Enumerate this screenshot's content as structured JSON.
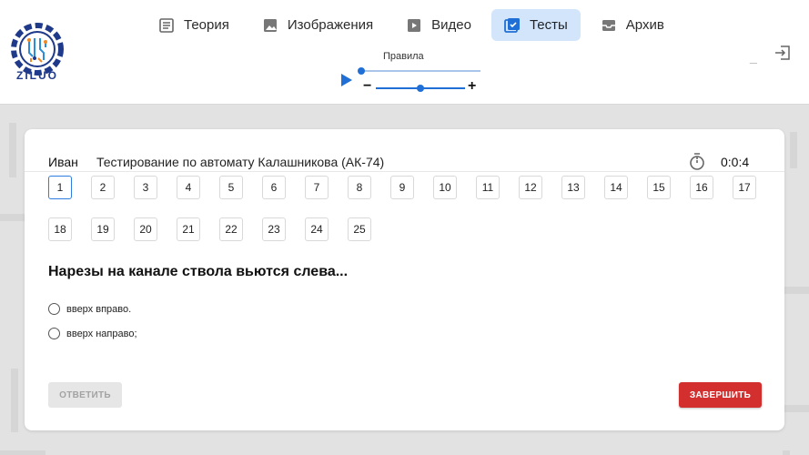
{
  "header": {
    "logo_text": "ZILUO",
    "nav": [
      {
        "label": "Теория",
        "icon": "book-icon",
        "active": false
      },
      {
        "label": "Изображения",
        "icon": "image-icon",
        "active": false
      },
      {
        "label": "Видео",
        "icon": "video-icon",
        "active": false
      },
      {
        "label": "Тесты",
        "icon": "test-icon",
        "active": true
      },
      {
        "label": "Архив",
        "icon": "archive-icon",
        "active": false
      }
    ],
    "rules_label": "Правила",
    "minus": "−",
    "plus": "+",
    "minimize": "_",
    "speed_level": 0.5
  },
  "test": {
    "user_name": "Иван",
    "title": "Тестирование по автомату Калашникова (АК-74)",
    "timer": "0:0:4",
    "questions": [
      "1",
      "2",
      "3",
      "4",
      "5",
      "6",
      "7",
      "8",
      "9",
      "10",
      "11",
      "12",
      "13",
      "14",
      "15",
      "16",
      "17",
      "18",
      "19",
      "20",
      "21",
      "22",
      "23",
      "24",
      "25"
    ],
    "current_question": "1",
    "question_text": "Нарезы на канале ствола вьются слева...",
    "options": [
      "вверх вправо.",
      "вверх направо;"
    ],
    "answer_label": "ОТВЕТИТЬ",
    "finish_label": "ЗАВЕРШИТЬ"
  },
  "colors": {
    "accent": "#1f6fd6",
    "active_tab_bg": "#d2e5fb",
    "finish": "#d32f2f"
  }
}
